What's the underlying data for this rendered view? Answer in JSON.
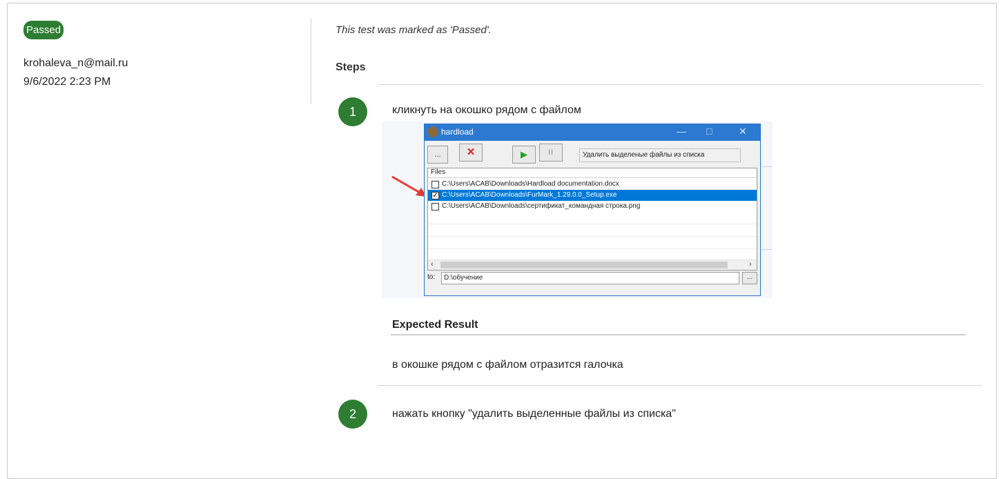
{
  "result": {
    "status": "Passed",
    "author": "krohaleva_n@mail.ru",
    "date": "9/6/2022 2:23 PM",
    "note": "This test was marked as 'Passed'."
  },
  "steps_heading": "Steps",
  "steps": [
    {
      "number": "1",
      "action": "кликнуть на окошко рядом с файлом",
      "expected_heading": "Expected Result",
      "expected": "в окошке рядом с файлом отразится галочка"
    },
    {
      "number": "2",
      "action": "нажать кнопку \"удалить выделенные файлы из списка\""
    }
  ],
  "screenshot": {
    "title": "hardload",
    "btn_browse": "...",
    "btn_delete": "✕",
    "btn_play": "▶",
    "btn_pause": "II",
    "status_text": "Удалить выделеные файлы из списка",
    "files_header": "Files",
    "files": [
      {
        "path": "C:\\Users\\ACAB\\Downloads\\Hardload documentation.docx",
        "checked": false
      },
      {
        "path": "C:\\Users\\ACAB\\Downloads\\FurMark_1.29.0.0_Setup.exe",
        "checked": true
      },
      {
        "path": "C:\\Users\\ACAB\\Downloads\\сертификат_командная строка.png",
        "checked": false
      }
    ],
    "to_label": "to:",
    "to_value": "D:\\обучение",
    "to_browse": "...",
    "colors": {
      "titlebar": "#2b79d0",
      "selection": "#0078d7",
      "arrow": "#e53935"
    }
  },
  "colors": {
    "badge": "#2e7d32",
    "step_circle": "#2e7d32"
  }
}
